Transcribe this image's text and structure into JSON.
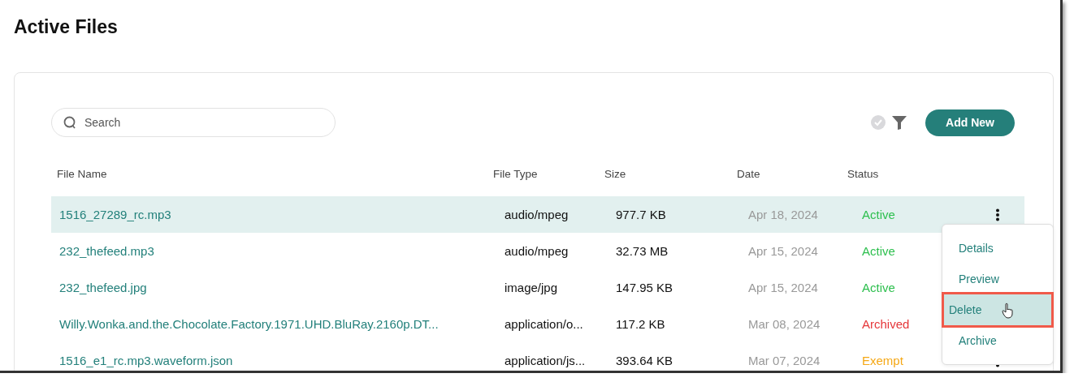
{
  "page": {
    "title": "Active Files"
  },
  "toolbar": {
    "search": {
      "placeholder": "Search"
    },
    "add_button": "Add New"
  },
  "table": {
    "columns": [
      "File Name",
      "File Type",
      "Size",
      "Date",
      "Status"
    ],
    "rows": [
      {
        "name": "1516_27289_rc.mp3",
        "type": "audio/mpeg",
        "size": "977.7 KB",
        "date": "Apr 18, 2024",
        "status": "Active",
        "color": "#2dbf4e",
        "selected": true
      },
      {
        "name": "232_thefeed.mp3",
        "type": "audio/mpeg",
        "size": "32.73 MB",
        "date": "Apr 15, 2024",
        "status": "Active",
        "color": "#2dbf4e",
        "selected": false
      },
      {
        "name": "232_thefeed.jpg",
        "type": "image/jpg",
        "size": "147.95 KB",
        "date": "Apr 15, 2024",
        "status": "Active",
        "color": "#2dbf4e",
        "selected": false
      },
      {
        "name": "Willy.Wonka.and.the.Chocolate.Factory.1971.UHD.BluRay.2160p.DT...",
        "type": "application/o...",
        "size": "117.2 KB",
        "date": "Mar 08, 2024",
        "status": "Archived",
        "color": "#e5373a",
        "selected": false
      },
      {
        "name": "1516_e1_rc.mp3.waveform.json",
        "type": "application/js...",
        "size": "393.64 KB",
        "date": "Mar 07, 2024",
        "status": "Exempt",
        "color": "#f5a816",
        "selected": false
      }
    ]
  },
  "context_menu": {
    "items": [
      {
        "label": "Details",
        "selected": false
      },
      {
        "label": "Preview",
        "selected": false
      },
      {
        "label": "Delete",
        "selected": true
      },
      {
        "label": "Archive",
        "selected": false
      }
    ]
  }
}
